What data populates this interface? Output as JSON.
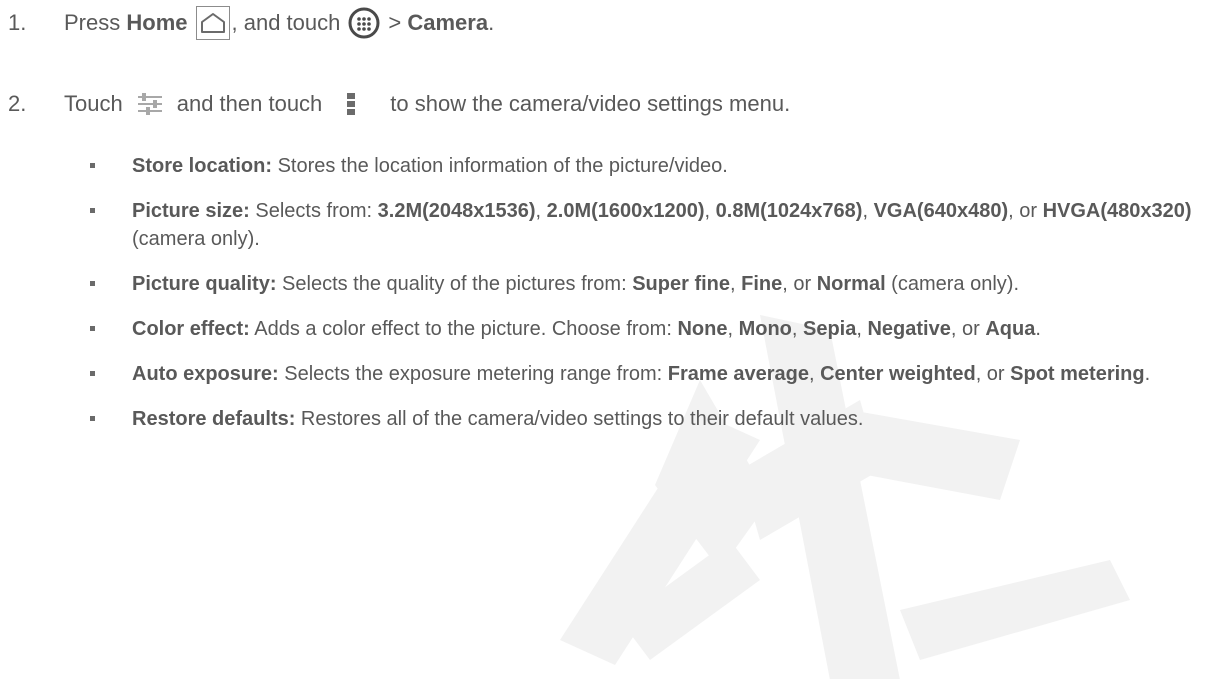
{
  "steps": [
    {
      "number": "1.",
      "text_press": "Press",
      "home_label": "Home",
      "text_touch": ", and touch",
      "text_gt": ">",
      "camera_label": "Camera",
      "text_end": "."
    },
    {
      "number": "2.",
      "text_touch": "Touch",
      "text_then": "and then touch",
      "text_end": "to show the camera/video settings menu."
    }
  ],
  "bullets": [
    {
      "label": "Store location:",
      "text": " Stores the location information of the picture/video."
    },
    {
      "label": "Picture size:",
      "t1": " Selects from: ",
      "o1": "3.2M(2048x1536)",
      "s1": ", ",
      "o2": "2.0M(1600x1200)",
      "s2": ", ",
      "o3": "0.8M(1024x768)",
      "s3": ", ",
      "o4": "VGA(640x480)",
      "s4": ", or ",
      "o5": "HVGA(480x320)",
      "t2": " (camera only)."
    },
    {
      "label": "Picture quality:",
      "t1": " Selects the quality of the pictures from: ",
      "o1": "Super fine",
      "s1": ", ",
      "o2": "Fine",
      "s2": ", or ",
      "o3": "Normal",
      "t2": " (camera only)."
    },
    {
      "label": "Color effect:",
      "t1": " Adds a color effect to the picture. Choose from: ",
      "o1": "None",
      "s1": ", ",
      "o2": "Mono",
      "s2": ", ",
      "o3": "Sepia",
      "s3": ", ",
      "o4": "Negative",
      "s4": ", or ",
      "o5": "Aqua",
      "t2": "."
    },
    {
      "label": "Auto exposure:",
      "t1": " Selects the exposure metering range from: ",
      "o1": "Frame average",
      "s1": ", ",
      "o2": "Center weighted",
      "s2": ", or ",
      "o3": "Spot metering",
      "t2": "."
    },
    {
      "label": "Restore defaults:",
      "text": " Restores all of the camera/video settings to their default values."
    }
  ],
  "icons": {
    "home": "home-icon",
    "apps": "apps-icon",
    "settings": "settings-sliders-icon",
    "menu": "menu-icon"
  },
  "colors": {
    "text": "#595959",
    "watermark": "#f2f2f2"
  }
}
